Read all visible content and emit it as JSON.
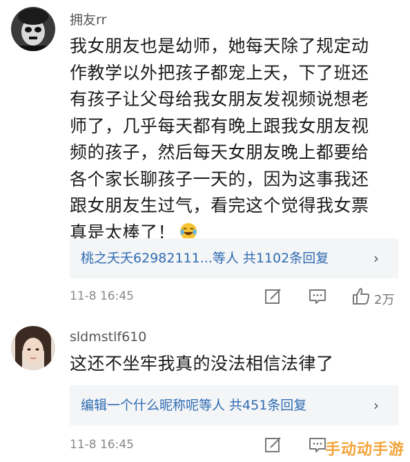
{
  "comments": [
    {
      "username": "拥友rr",
      "text_lines": [
        "我女朋友也是幼师，她每天除了规定动",
        "作教学以外把孩子都宠上天，下了班还",
        "有孩子让父母给我女朋友发视频说想老",
        "师了，几乎每天都有晚上跟我女朋友视",
        "频的孩子，然后每天女朋友晚上都要给",
        "各个家长聊孩子一天的，因为这事我还",
        "跟女朋友生过气，看完这个觉得我女票",
        "真是太棒了！"
      ],
      "emoji": "laughing-with-tears-emoji",
      "reply_summary": "桃之夭夭62982111...等人 共1102条回复",
      "timestamp": "11-8 16:45",
      "like_count": "2万"
    },
    {
      "username": "sldmstlf610",
      "text_lines": [
        "这还不坐牢我真的没法相信法律了"
      ],
      "reply_summary": "编辑一个什么昵称呢等人 共451条回复",
      "timestamp": "11-8 16:45"
    }
  ],
  "reply_chevron": "›",
  "watermark": "手动动手游",
  "colors": {
    "link": "#2f6bb2",
    "reply_bg": "#f3f5f7",
    "meta": "#888888",
    "watermark": "#f2a43a"
  }
}
